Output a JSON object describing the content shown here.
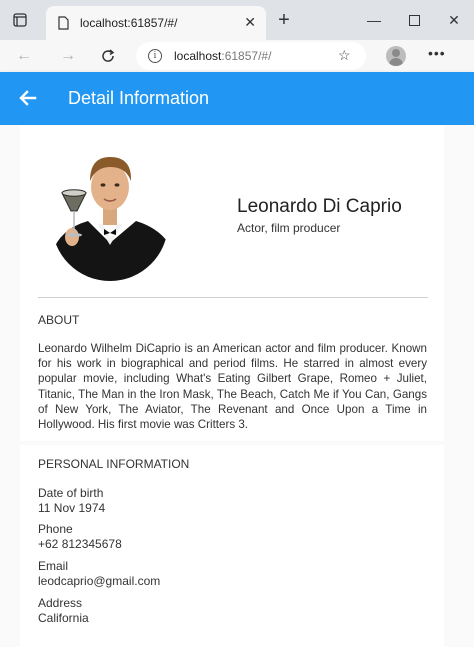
{
  "browser": {
    "tab_title": "localhost:61857/#/",
    "url_host": "localhost",
    "url_rest": ":61857/#/"
  },
  "appbar": {
    "title": "Detail Information"
  },
  "profile": {
    "name": "Leonardo Di Caprio",
    "role": "Actor, film producer"
  },
  "about": {
    "heading": "ABOUT",
    "text": "Leonardo Wilhelm DiCaprio is an American actor and film producer. Known for his work in biographical and period films. He starred in almost every popular movie, including What's Eating Gilbert Grape, Romeo + Juliet, Titanic, The Man in the Iron Mask, The Beach, Catch Me if You Can, Gangs of New York, The Aviator, The Revenant and Once Upon a Time in Hollywood. His first movie was Critters 3."
  },
  "personal": {
    "heading": "PERSONAL INFORMATION",
    "fields": [
      {
        "label": "Date of birth",
        "value": "11 Nov 1974"
      },
      {
        "label": "Phone",
        "value": "+62 812345678"
      },
      {
        "label": "Email",
        "value": "leodcaprio@gmail.com"
      },
      {
        "label": "Address",
        "value": "California"
      }
    ]
  },
  "colors": {
    "appbar": "#2196f3",
    "appbar_text": "#ffffff"
  }
}
